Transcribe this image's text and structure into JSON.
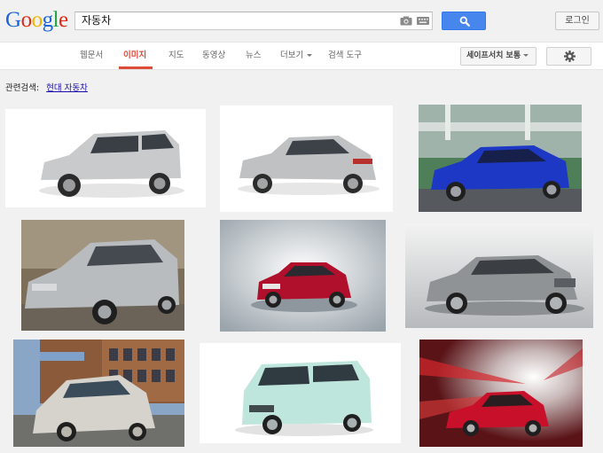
{
  "logo": {
    "letters": [
      "G",
      "o",
      "o",
      "g",
      "l",
      "e"
    ]
  },
  "search": {
    "value": "자동차"
  },
  "header": {
    "login_label": "로그인"
  },
  "tabs": [
    {
      "label": "웹문서",
      "active": false
    },
    {
      "label": "이미지",
      "active": true
    },
    {
      "label": "지도",
      "active": false
    },
    {
      "label": "동영상",
      "active": false
    },
    {
      "label": "뉴스",
      "active": false
    },
    {
      "label": "더보기",
      "active": false
    },
    {
      "label": "검색 도구",
      "active": false
    }
  ],
  "safesearch": {
    "label": "세이프서치 보통"
  },
  "related": {
    "label": "관련검색:",
    "link": "현대 자동차"
  },
  "results": [
    {
      "icon": "silver-minivan-image",
      "bg": "#ffffff",
      "car": "#c8cacc"
    },
    {
      "icon": "silver-sedan-image",
      "bg": "#ffffff",
      "car": "#bfc1c3"
    },
    {
      "icon": "blue-sedan-image",
      "bg": "#5e8f63",
      "car": "#1d38c4"
    },
    {
      "icon": "silver-hatchback-image",
      "bg": "#8a7b66",
      "car": "#b9bcbe"
    },
    {
      "icon": "red-sedan-image",
      "bg": "#dfe3e6",
      "car": "#b0102c"
    },
    {
      "icon": "silver-luxury-sedan-image",
      "bg": "#cfd1d3",
      "car": "#8f9396"
    },
    {
      "icon": "concept-car-image",
      "bg": "#8aa6c6",
      "car": "#d6d3cc"
    },
    {
      "icon": "mint-compact-car-image",
      "bg": "#ffffff",
      "car": "#bfe6dc"
    },
    {
      "icon": "red-sports-sedan-image",
      "bg": "#6a1a1e",
      "car": "#c8102a"
    }
  ]
}
